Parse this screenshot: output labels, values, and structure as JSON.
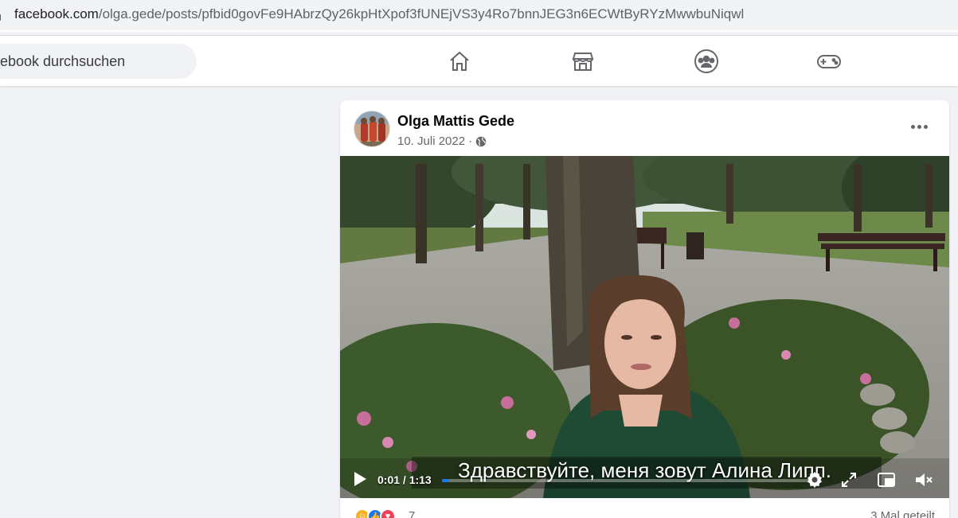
{
  "browser": {
    "url_domain": "facebook.com",
    "url_path": "/olga.gede/posts/pfbid0govFe9HAbrzQy26kpHtXpof3fUNEjVS3y4Ro7bnnJEG3n6ECWtByRYzMwwbuNiqwl"
  },
  "topnav": {
    "search_placeholder": "ebook durchsuchen",
    "icons": [
      "home-icon",
      "marketplace-icon",
      "groups-icon",
      "gaming-icon"
    ]
  },
  "post": {
    "author": "Olga Mattis Gede",
    "date": "10. Juli 2022",
    "separator": "·",
    "audience_icon": "globe-icon",
    "video": {
      "subtitle": "Здравствуйте, меня зовут Алина Липп.",
      "time": "0:01 / 1:13",
      "progress": 0.013
    },
    "reactions": {
      "count": "7",
      "types": [
        "haha",
        "like",
        "love"
      ]
    },
    "shares": "3 Mal geteilt"
  },
  "colors": {
    "accent": "#1877f2",
    "background": "#f0f2f5"
  }
}
